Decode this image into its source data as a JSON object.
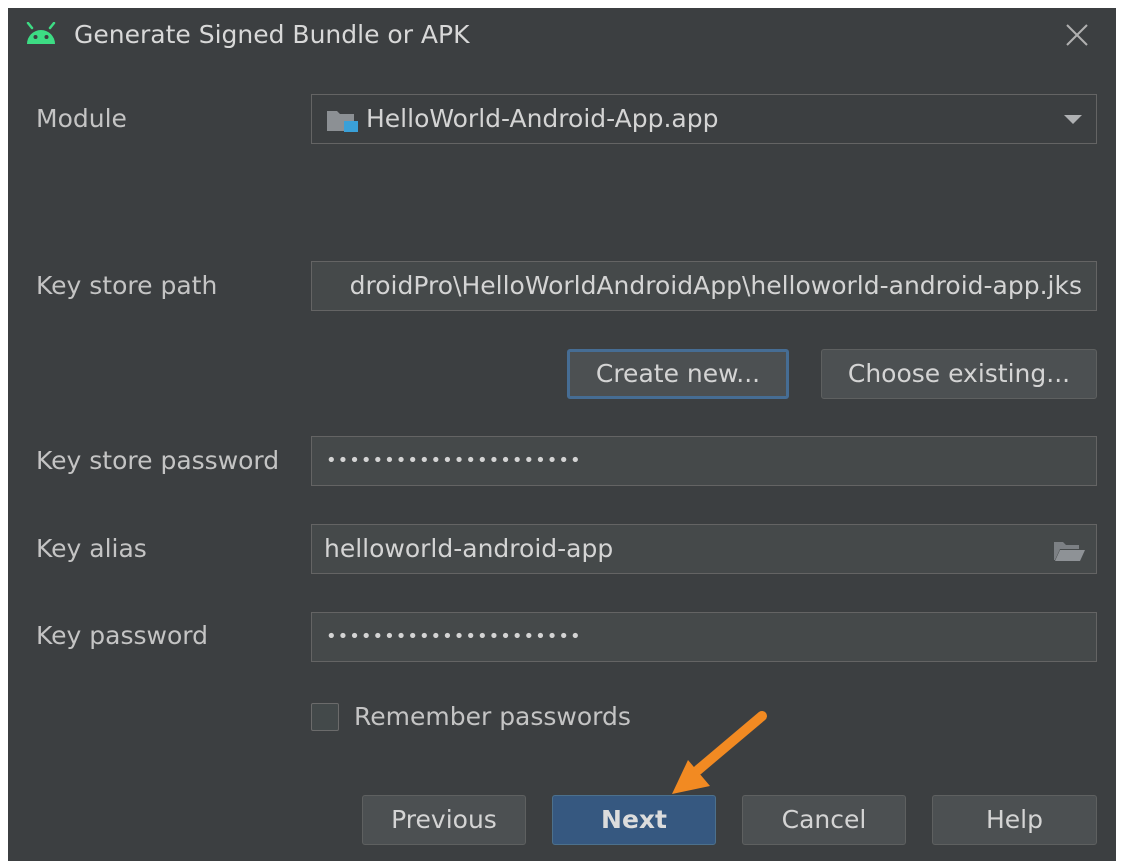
{
  "window": {
    "title": "Generate Signed Bundle or APK",
    "title_icon": "android-icon",
    "close_icon": "close-icon"
  },
  "form": {
    "module": {
      "label": "Module",
      "value": "HelloWorld-Android-App.app",
      "icon": "module-folder-icon"
    },
    "key_store_path": {
      "label": "Key store path",
      "value": "droidPro\\HelloWorldAndroidApp\\helloworld-android-app.jks"
    },
    "key_store_buttons": {
      "create_new": "Create new...",
      "choose_existing": "Choose existing..."
    },
    "key_store_password": {
      "label": "Key store password",
      "value": "••••••••••••••••••••••"
    },
    "key_alias": {
      "label": "Key alias",
      "value": "helloworld-android-app",
      "icon": "folder-open-icon"
    },
    "key_password": {
      "label": "Key password",
      "value": "••••••••••••••••••••••"
    },
    "remember_passwords": {
      "label": "Remember passwords",
      "checked": false
    }
  },
  "footer": {
    "previous": "Previous",
    "next": "Next",
    "cancel": "Cancel",
    "help": "Help"
  },
  "colors": {
    "background": "#3c3f41",
    "field": "#45494a",
    "primary_button": "#365880",
    "annotation_arrow": "#f28a22"
  }
}
